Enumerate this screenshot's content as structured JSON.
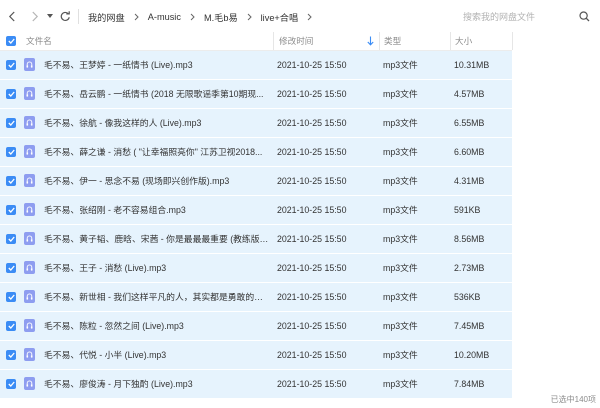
{
  "breadcrumb": [
    "我的网盘",
    "A-music",
    "M.毛b易",
    "live+合唱"
  ],
  "search": {
    "placeholder": "搜索我的网盘文件"
  },
  "columns": {
    "name": "文件名",
    "modified": "修改时间",
    "type": "类型",
    "size": "大小"
  },
  "sort": {
    "column": "modified",
    "direction": "descending"
  },
  "files": [
    {
      "name": "毛不易、王梦婷 - 一纸情书 (Live).mp3",
      "modified": "2021-10-25 15:50",
      "type": "mp3文件",
      "size": "10.31MB",
      "selected": true
    },
    {
      "name": "毛不易、岳云鹏 - 一纸情书 (2018 无限歌谣季第10期现...",
      "modified": "2021-10-25 15:50",
      "type": "mp3文件",
      "size": "4.57MB",
      "selected": true
    },
    {
      "name": "毛不易、徐航 - 像我这样的人 (Live).mp3",
      "modified": "2021-10-25 15:50",
      "type": "mp3文件",
      "size": "6.55MB",
      "selected": true
    },
    {
      "name": "毛不易、薛之谦 - 消愁 ( \"让幸福照亮你\" 江苏卫视2018...",
      "modified": "2021-10-25 15:50",
      "type": "mp3文件",
      "size": "6.60MB",
      "selected": true
    },
    {
      "name": "毛不易、伊一 - 思念不易 (现场即兴创作版).mp3",
      "modified": "2021-10-25 15:50",
      "type": "mp3文件",
      "size": "4.31MB",
      "selected": true
    },
    {
      "name": "毛不易、张绍刚 - 老不容易组合.mp3",
      "modified": "2021-10-25 15:50",
      "type": "mp3文件",
      "size": "591KB",
      "selected": true
    },
    {
      "name": "毛不易、黄子韬、鹿晗、宋茜 - 你是最最最重要 (教练版).m...",
      "modified": "2021-10-25 15:50",
      "type": "mp3文件",
      "size": "8.56MB",
      "selected": true
    },
    {
      "name": "毛不易、王子 - 消愁 (Live).mp3",
      "modified": "2021-10-25 15:50",
      "type": "mp3文件",
      "size": "2.73MB",
      "selected": true
    },
    {
      "name": "毛不易、新世相 - 我们这样平凡的人，其实都是勇敢的人...",
      "modified": "2021-10-25 15:50",
      "type": "mp3文件",
      "size": "536KB",
      "selected": true
    },
    {
      "name": "毛不易、陈粒 - 忽然之间 (Live).mp3",
      "modified": "2021-10-25 15:50",
      "type": "mp3文件",
      "size": "7.45MB",
      "selected": true
    },
    {
      "name": "毛不易、代悦 - 小半 (Live).mp3",
      "modified": "2021-10-25 15:50",
      "type": "mp3文件",
      "size": "10.20MB",
      "selected": true
    },
    {
      "name": "毛不易、廖俊涛 - 月下独酌 (Live).mp3",
      "modified": "2021-10-25 15:50",
      "type": "mp3文件",
      "size": "7.84MB",
      "selected": true
    }
  ],
  "status": "已选中140项",
  "colors": {
    "accent": "#3b8cf5",
    "row_selected": "#e6f3fd",
    "file_icon": "#8e9df0"
  },
  "icons": [
    "back-arrow-icon",
    "forward-arrow-icon",
    "dropdown-arrow-icon",
    "refresh-icon",
    "chevron-right-icon",
    "search-icon",
    "sort-arrow-icon",
    "music-file-icon",
    "check-icon"
  ]
}
